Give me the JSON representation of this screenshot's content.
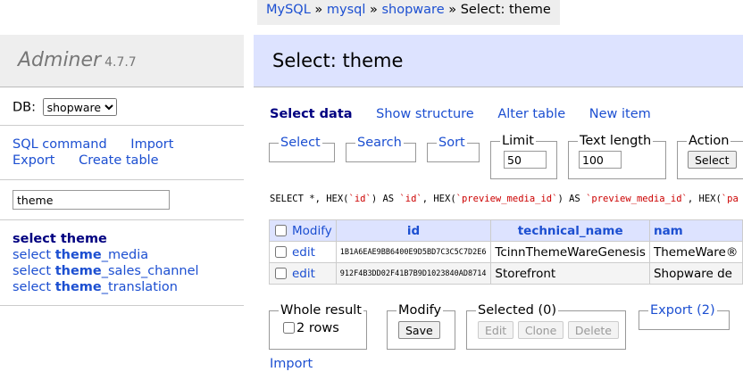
{
  "breadcrumb": {
    "items": [
      "MySQL",
      "mysql",
      "shopware"
    ],
    "separator": "»",
    "current": "Select: theme"
  },
  "logo": {
    "name": "Adminer",
    "version": "4.7.7"
  },
  "db": {
    "label": "DB:",
    "selected": "shopware"
  },
  "commands": {
    "sql_command": "SQL command",
    "import": "Import",
    "export": "Export",
    "create_table": "Create table"
  },
  "filter": {
    "value": "theme"
  },
  "tables": [
    {
      "action": "select",
      "name": "theme",
      "suffix": ""
    },
    {
      "action": "select",
      "name": "theme",
      "suffix": "_media"
    },
    {
      "action": "select",
      "name": "theme",
      "suffix": "_sales_channel"
    },
    {
      "action": "select",
      "name": "theme",
      "suffix": "_translation"
    }
  ],
  "page_title": "Select: theme",
  "tabs": {
    "select_data": "Select data",
    "show_structure": "Show structure",
    "alter_table": "Alter table",
    "new_item": "New item"
  },
  "form": {
    "select": "Select",
    "search": "Search",
    "sort": "Sort",
    "limit_label": "Limit",
    "limit_value": "50",
    "text_length_label": "Text length",
    "text_length_value": "100",
    "action_label": "Action",
    "action_button": "Select"
  },
  "sql_query": {
    "p1": "SELECT *, HEX(",
    "p2": "`id`",
    "p3": ") AS ",
    "p4": "`id`",
    "p5": ", HEX(",
    "p6": "`preview_media_id`",
    "p7": ") AS ",
    "p8": "`preview_media_id`",
    "p9": ", HEX(",
    "p10": "`pa"
  },
  "table": {
    "modify_header": "Modify",
    "columns": [
      "id",
      "technical_name",
      "nam"
    ],
    "rows": [
      {
        "edit": "edit",
        "id": "1B1A6EAE9BB6400E9D5BD7C3C5C7D2E6",
        "technical_name": "TcinnThemeWareGenesis",
        "name": "ThemeWare®"
      },
      {
        "edit": "edit",
        "id": "912F4B3DD02F41B7B9D1023840AD8714",
        "technical_name": "Storefront",
        "name": "Shopware de"
      }
    ]
  },
  "bottom": {
    "whole_result_label": "Whole result",
    "rows_count": "2 rows",
    "modify_label": "Modify",
    "save_button": "Save",
    "selected_label": "Selected (0)",
    "edit_button": "Edit",
    "clone_button": "Clone",
    "delete_button": "Delete",
    "export_label": "Export (2)",
    "import_link": "Import"
  }
}
